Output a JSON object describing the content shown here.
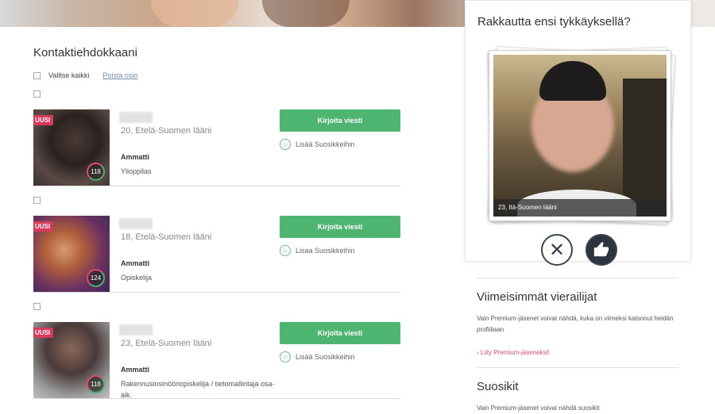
{
  "main": {
    "title": "Kontaktiehdokkaani",
    "select_all_label": "Valitse kaikki",
    "remove_link": "Poista osio",
    "cards": [
      {
        "badge": "UUSI",
        "score": "118",
        "location": "20, Etelä-Suomen lääni",
        "job_label": "Ammatti",
        "job": "Ylioppilas",
        "button": "Kirjoita viesti",
        "favorite": "Lisää Suosikkeihin"
      },
      {
        "badge": "UUSI",
        "score": "124",
        "location": "18, Etelä-Suomen lääni",
        "job_label": "Ammatti",
        "job": "Opiskelija",
        "button": "Kirjoita viesti",
        "favorite": "Lisaa Suosikkeihin"
      },
      {
        "badge": "UUSI",
        "score": "118",
        "location": "23, Etelä-Suomen lääni",
        "job_label": "Ammatti",
        "job": "Rakennusinsinööriopiskelija / tietomallintaja osa-aik.",
        "button": "Kirjoita viesti",
        "favorite": "Lisää Suosikkeihin"
      }
    ]
  },
  "sidebar": {
    "match_title": "Rakkautta ensi tykkäyksellä?",
    "match_caption": "23, Itä-Suomen lääni",
    "visitors_title": "Viimeisimmät vierailijat",
    "visitors_text": "Vain Premium-jäsenet voivat nähdä, kuka on viimeksi katsonut heidän profiiliaan",
    "visitors_link": "Liity Premium-jäseneksi!",
    "favorites_title": "Suosikit",
    "favorites_text": "Vain Premium-jäsenet voivat nähdä suosikit"
  },
  "colors": {
    "green": "#4db56f",
    "badge": "#d63b5a",
    "dark": "#2c3440"
  }
}
